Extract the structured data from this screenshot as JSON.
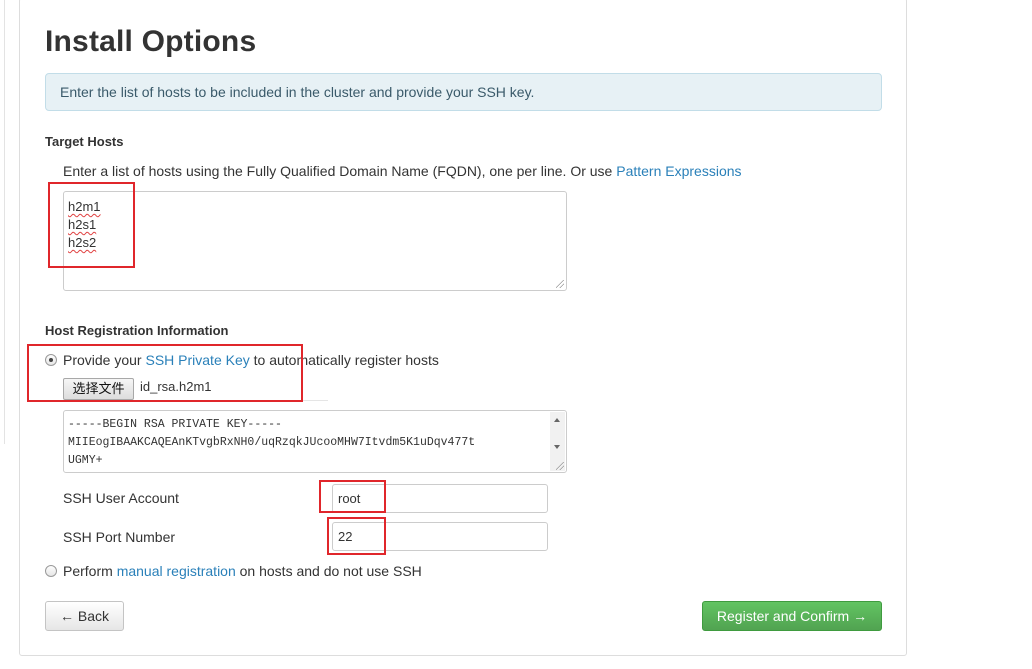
{
  "page": {
    "title": "Install Options",
    "info_message": "Enter the list of hosts to be included in the cluster and provide your SSH key."
  },
  "target_hosts": {
    "section_title": "Target Hosts",
    "instruction": "Enter a list of hosts using the Fully Qualified Domain Name (FQDN), one per line. Or use",
    "pattern_link": "Pattern Expressions",
    "hosts": [
      "h2m1",
      "h2s1",
      "h2s2"
    ]
  },
  "registration": {
    "section_title": "Host Registration Information",
    "ssh_option": {
      "selected": true,
      "prefix": "Provide your",
      "link": "SSH Private Key",
      "suffix": "to automatically register hosts"
    },
    "file_picker": {
      "button_label": "选择文件",
      "file_name": "id_rsa.h2m1"
    },
    "private_key_lines": [
      "-----BEGIN RSA PRIVATE KEY-----",
      "MIIEogIBAAKCAQEAnKTvgbRxNH0/uqRzqkJUcooMHW7Itvdm5K1uDqv477t",
      "UGMY+"
    ],
    "ssh_user": {
      "label": "SSH User Account",
      "value": "root"
    },
    "ssh_port": {
      "label": "SSH Port Number",
      "value": "22"
    },
    "manual_option": {
      "selected": false,
      "prefix": "Perform",
      "link": "manual registration",
      "suffix": "on hosts and do not use SSH"
    }
  },
  "buttons": {
    "back": "← Back",
    "register": "Register and Confirm →"
  },
  "colors": {
    "link": "#2a80b9",
    "success": "#51a351",
    "annotation": "#e0262b",
    "info_bg": "#e7f1f5"
  }
}
